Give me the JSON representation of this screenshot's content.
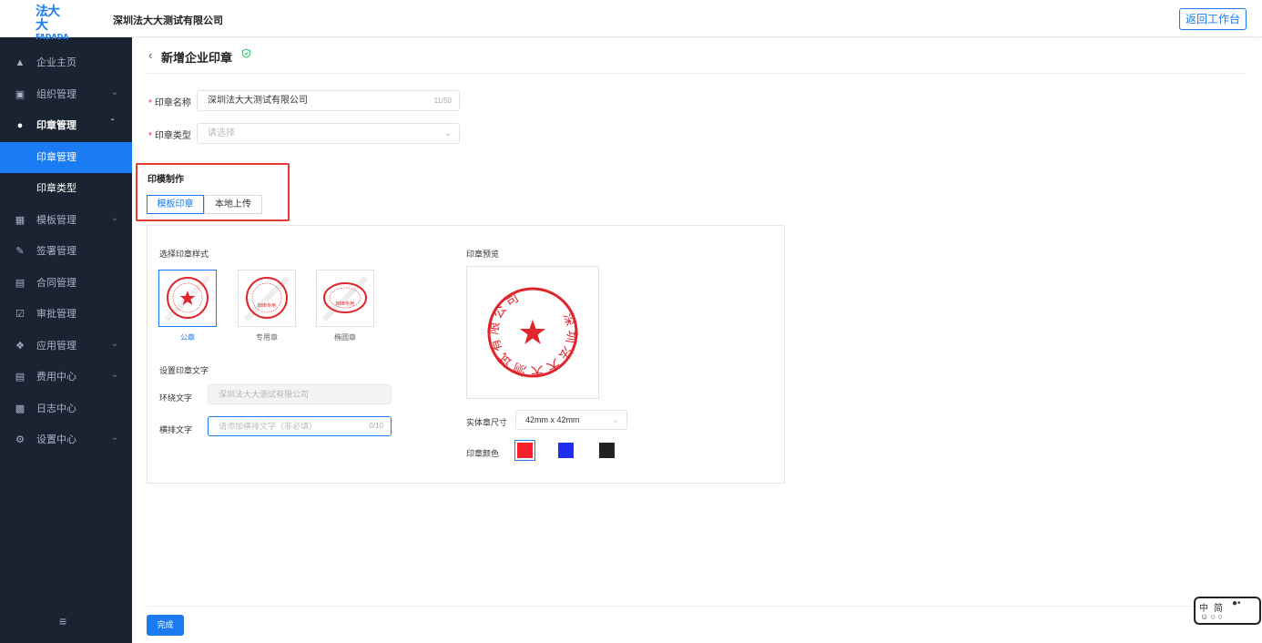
{
  "header": {
    "logo_cn": "法大大",
    "logo_en": "FADADA",
    "company": "深圳法大大测试有限公司",
    "back_button": "返回工作台"
  },
  "sidebar": {
    "items": [
      {
        "label": "企业主页",
        "icon": "home-icon"
      },
      {
        "label": "组织管理",
        "icon": "org-icon"
      },
      {
        "label": "印章管理",
        "icon": "user-icon"
      },
      {
        "label": "印章管理",
        "icon": ""
      },
      {
        "label": "印章类型",
        "icon": ""
      },
      {
        "label": "模板管理",
        "icon": "grid-icon"
      },
      {
        "label": "签署管理",
        "icon": "pen-icon"
      },
      {
        "label": "合同管理",
        "icon": "file-icon"
      },
      {
        "label": "审批管理",
        "icon": "check-icon"
      },
      {
        "label": "应用管理",
        "icon": "app-icon"
      },
      {
        "label": "费用中心",
        "icon": "fee-icon"
      },
      {
        "label": "日志中心",
        "icon": "log-icon"
      },
      {
        "label": "设置中心",
        "icon": "gear-icon"
      }
    ]
  },
  "page": {
    "title": "新增企业印章",
    "seal_name_label": "印章名称",
    "seal_name_value": "深圳法大大测试有限公司",
    "seal_name_count": "11/50",
    "seal_type_label": "印章类型",
    "seal_type_placeholder": "请选择",
    "make_title": "印模制作",
    "tab_template": "模板印章",
    "tab_upload": "本地上传",
    "choose_style": "选择印章样式",
    "styles": [
      "公章",
      "专用章",
      "椭圆章"
    ],
    "set_text": "设置印章文字",
    "ring_label": "环绕文字",
    "ring_value": "深圳法大大测试有限公司",
    "horiz_label": "横排文字",
    "horiz_placeholder": "请添加横排文字（非必填）",
    "horiz_count": "0/10",
    "preview_title": "印章预览",
    "size_label": "实体章尺寸",
    "size_value": "42mm x 42mm",
    "color_label": "印章颜色",
    "colors": [
      "#f5222d",
      "#1f2ef2",
      "#222222"
    ],
    "done_button": "完成"
  },
  "stamp_preview_text": "深圳法大大测试有限公司",
  "mini_stamp_text": {
    "special": "BBB专用",
    "oval": "BBB专用"
  },
  "ime": {
    "char": "中",
    "char2": "简"
  }
}
